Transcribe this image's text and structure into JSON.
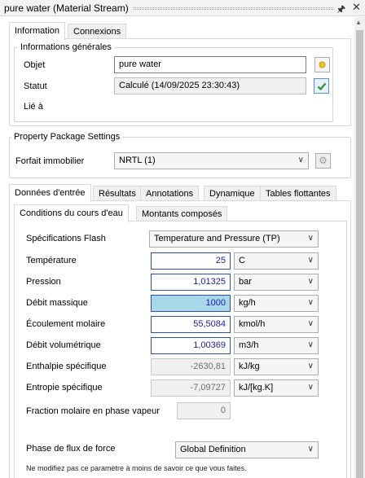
{
  "window": {
    "title": "pure water (Material Stream)"
  },
  "top_tabs": [
    "Information",
    "Connexions"
  ],
  "info": {
    "group_title": "Informations générales",
    "object_label": "Objet",
    "object_value": "pure water",
    "status_label": "Statut",
    "status_value": "Calculé (14/09/2025 23:30:43)",
    "linked_label": "Lié à"
  },
  "property_package": {
    "group_title": "Property Package Settings",
    "label": "Forfait immobilier",
    "value": "NRTL (1)"
  },
  "main_tabs": [
    "Données d'entrée",
    "Résultats",
    "Annotations",
    "Dynamique",
    "Tables flottantes"
  ],
  "sub_tabs": [
    "Conditions du cours d'eau",
    "Montants composés"
  ],
  "conditions": {
    "flash_label": "Spécifications Flash",
    "flash_value": "Temperature and Pressure (TP)",
    "rows": [
      {
        "label": "Température",
        "value": "25",
        "unit": "C"
      },
      {
        "label": "Pression",
        "value": "1,01325",
        "unit": "bar"
      },
      {
        "label": "Débit massique",
        "value": "1000",
        "unit": "kg/h"
      },
      {
        "label": "Écoulement molaire",
        "value": "55,5084",
        "unit": "kmol/h"
      },
      {
        "label": "Débit volumétrique",
        "value": "1,00369",
        "unit": "m3/h"
      },
      {
        "label": "Enthalpie spécifique",
        "value": "-2630,81",
        "unit": "kJ/kg"
      },
      {
        "label": "Entropie spécifique",
        "value": "-7,09727",
        "unit": "kJ/[kg.K]"
      }
    ],
    "vapor_label": "Fraction molaire en phase vapeur",
    "vapor_value": "0",
    "phase_label": "Phase de flux de force",
    "phase_value": "Global Definition",
    "note": "Ne modifiez pas ce paramètre à moins de savoir ce que vous faites."
  },
  "colors": {
    "accent": "#2e4fb0",
    "highlight": "#a8d7ea",
    "ok": "#2f8f2f"
  }
}
